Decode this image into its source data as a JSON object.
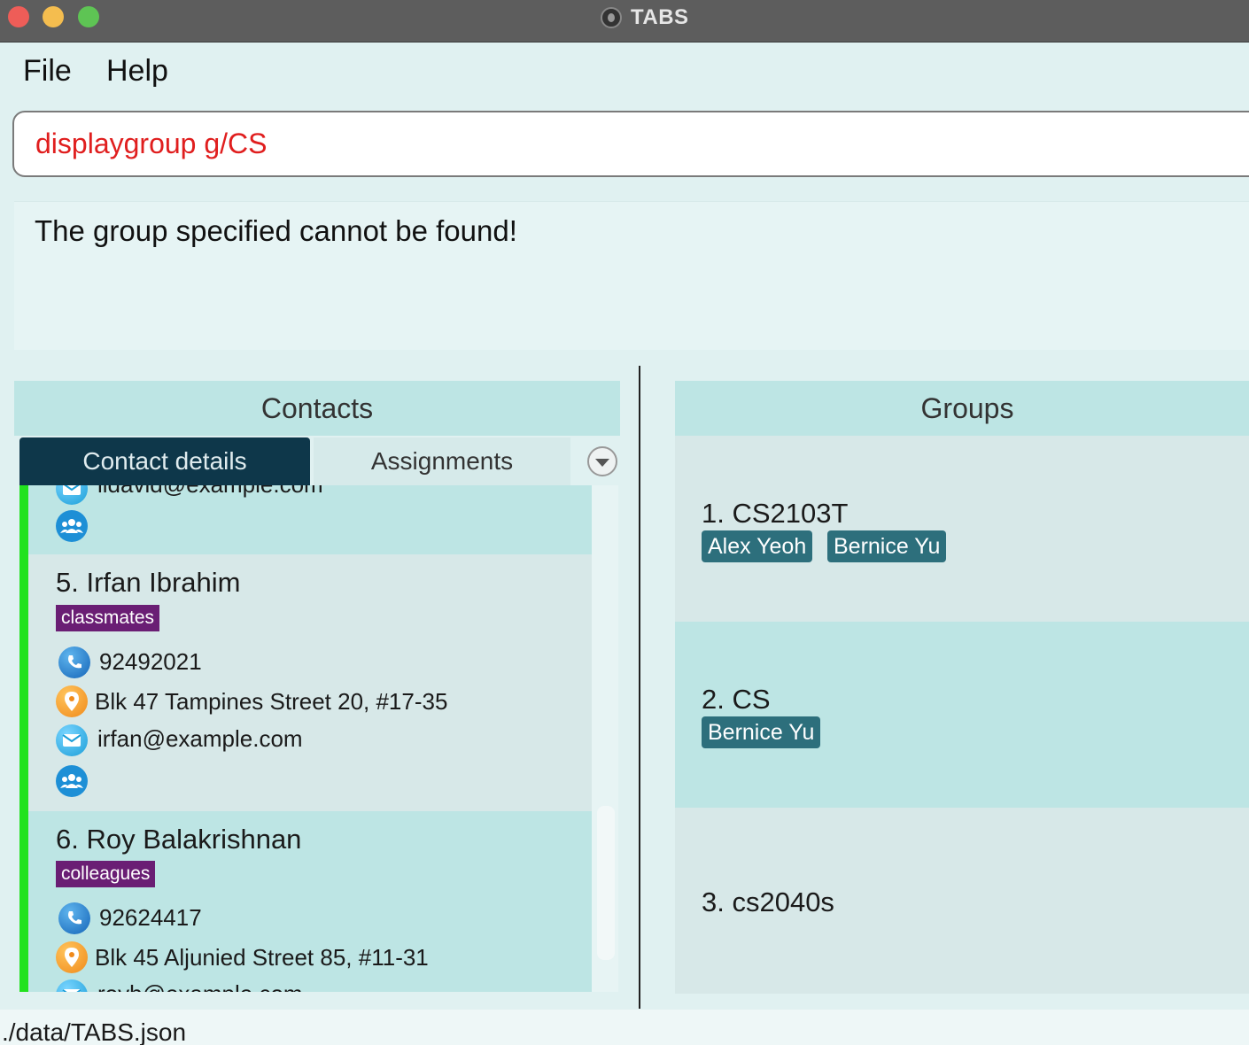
{
  "window": {
    "title": "TABS"
  },
  "menu": {
    "file": "File",
    "help": "Help"
  },
  "command": {
    "value": "displaygroup g/CS"
  },
  "result": {
    "message": "The group specified cannot be found!"
  },
  "contacts": {
    "header": "Contacts",
    "tabs": {
      "details": "Contact details",
      "assignments": "Assignments"
    },
    "partial_top_email": "lidavid@example.com",
    "items": [
      {
        "index_name": "5.  Irfan Ibrahim",
        "tag": "classmates",
        "phone": "92492021",
        "address": "Blk 47 Tampines Street 20, #17-35",
        "email": "irfan@example.com"
      },
      {
        "index_name": "6.  Roy Balakrishnan",
        "tag": "colleagues",
        "phone": "92624417",
        "address": "Blk 45 Aljunied Street 85, #11-31",
        "email": "royb@example.com"
      }
    ]
  },
  "groups": {
    "header": "Groups",
    "items": [
      {
        "index_name": "1.  CS2103T",
        "members": [
          "Alex Yeoh",
          "Bernice Yu"
        ]
      },
      {
        "index_name": "2.  CS",
        "members": [
          "Bernice Yu"
        ]
      },
      {
        "index_name": "3.  cs2040s",
        "members": []
      }
    ]
  },
  "status": {
    "path": "./data/TABS.json"
  },
  "icons": {
    "phone": "phone-icon",
    "location": "location-pin-icon",
    "email": "envelope-icon",
    "group": "people-group-icon",
    "dropdown": "chevron-down-icon"
  },
  "colors": {
    "command_text": "#e01e1e",
    "tag_bg": "#6a1e74",
    "member_bg": "#2d6f7c",
    "active_tab": "#0e374a",
    "selection_bar": "#22e21e"
  }
}
